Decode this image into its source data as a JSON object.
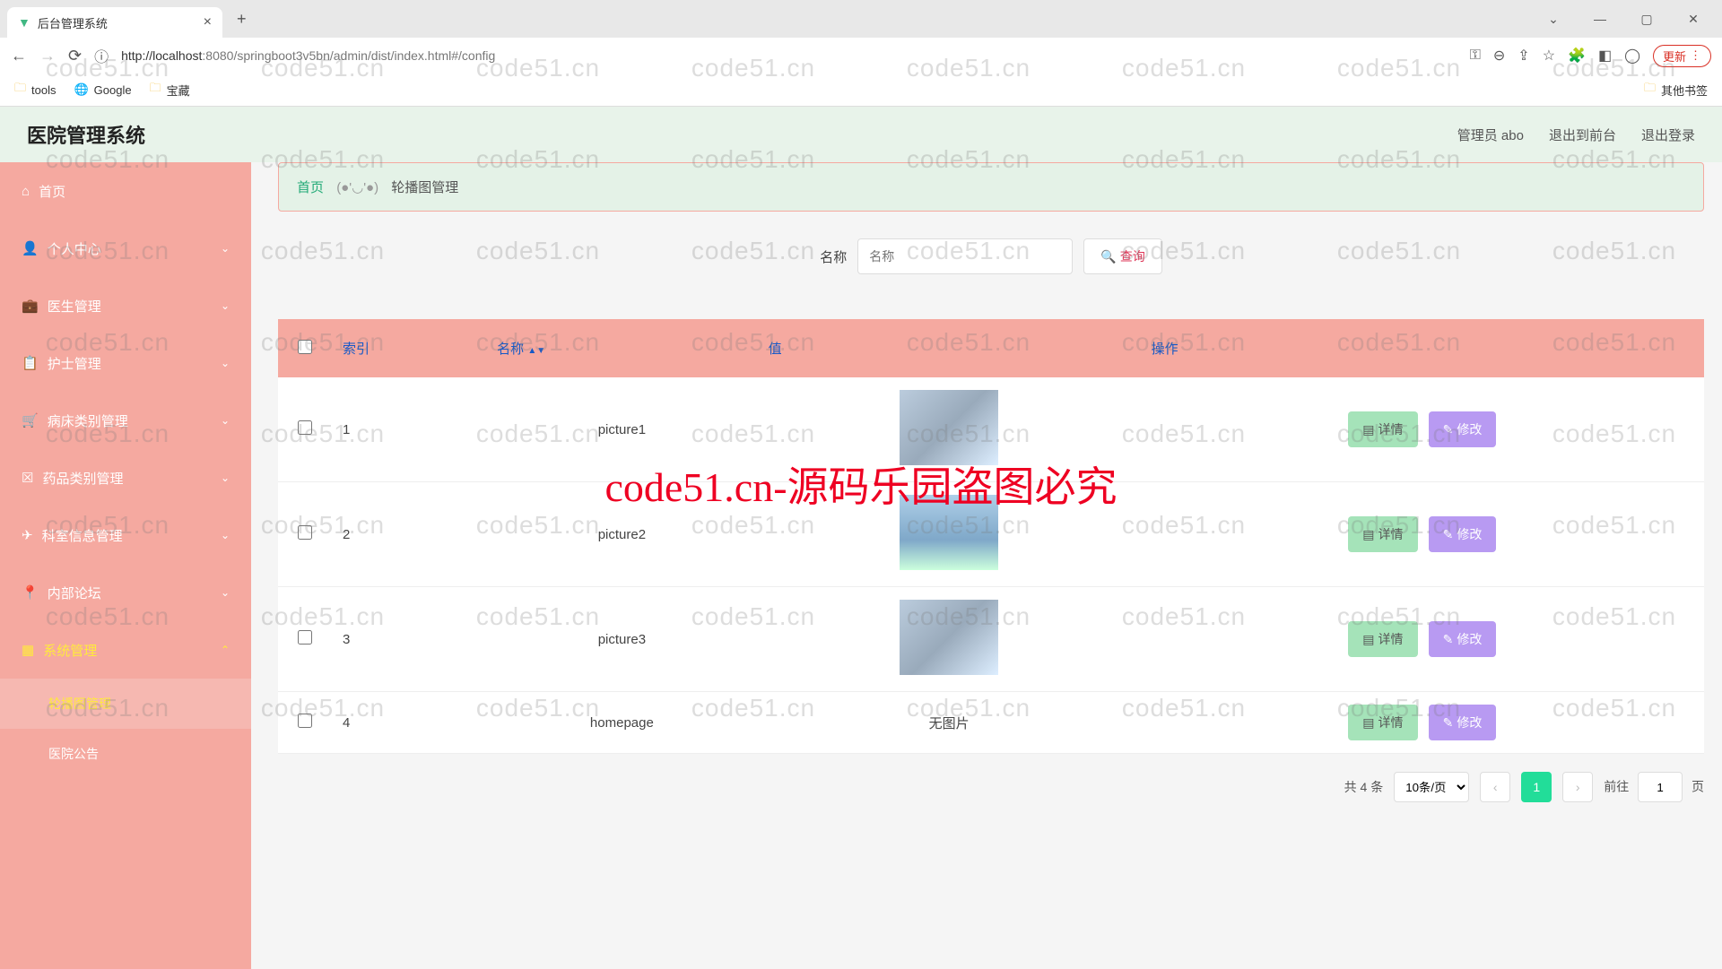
{
  "browser": {
    "tab_title": "后台管理系统",
    "url_host": "localhost",
    "url_port": ":8080",
    "url_path": "/springboot3v5bn/admin/dist/index.html#/config",
    "update_label": "更新"
  },
  "bookmarks": {
    "tools": "tools",
    "google": "Google",
    "treasure": "宝藏",
    "other": "其他书签"
  },
  "header": {
    "title": "医院管理系统",
    "admin": "管理员 abo",
    "to_front": "退出到前台",
    "logout": "退出登录"
  },
  "sidebar": {
    "home": "首页",
    "profile": "个人中心",
    "doctor": "医生管理",
    "nurse": "护士管理",
    "bed_type": "病床类别管理",
    "drug_type": "药品类别管理",
    "dept_info": "科室信息管理",
    "forum": "内部论坛",
    "system": "系统管理",
    "carousel": "轮播图管理",
    "notice": "医院公告"
  },
  "breadcrumb": {
    "home": "首页",
    "sep": "(●'◡'●)",
    "current": "轮播图管理"
  },
  "search": {
    "label": "名称",
    "placeholder": "名称",
    "button": "查询"
  },
  "table": {
    "col_index": "索引",
    "col_name": "名称",
    "col_value": "值",
    "col_op": "操作",
    "btn_detail": "详情",
    "btn_edit": "修改",
    "no_image": "无图片",
    "rows": [
      {
        "idx": "1",
        "name": "picture1",
        "has_img": true
      },
      {
        "idx": "2",
        "name": "picture2",
        "has_img": true
      },
      {
        "idx": "3",
        "name": "picture3",
        "has_img": true
      },
      {
        "idx": "4",
        "name": "homepage",
        "has_img": false
      }
    ]
  },
  "pagination": {
    "total": "共 4 条",
    "page_size": "10条/页",
    "current": "1",
    "goto_prefix": "前往",
    "goto_value": "1",
    "goto_suffix": "页"
  },
  "watermark": {
    "text": "code51.cn",
    "big": "code51.cn-源码乐园盗图必究"
  }
}
